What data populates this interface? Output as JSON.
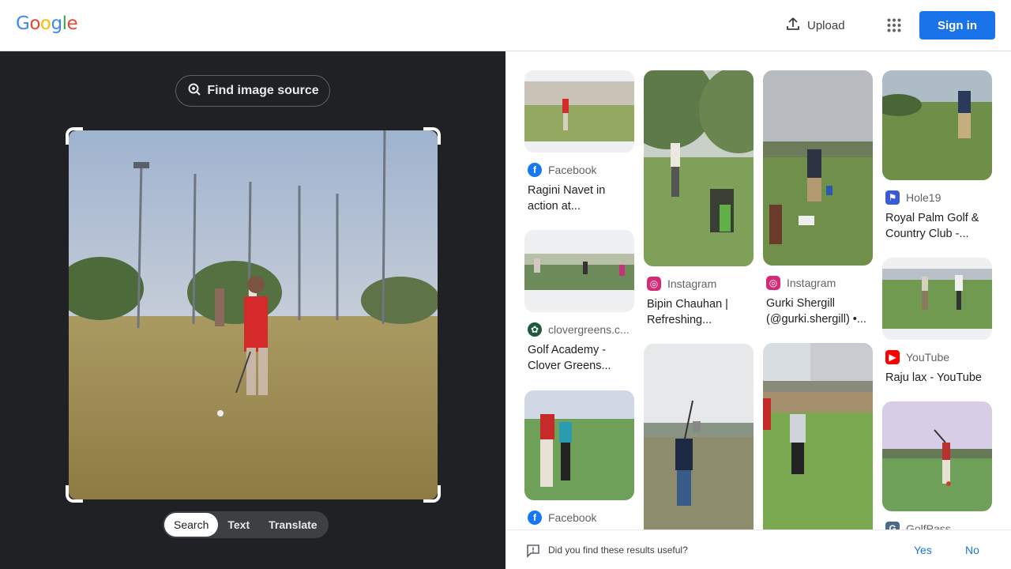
{
  "header": {
    "logo_letters": [
      "G",
      "o",
      "o",
      "g",
      "l",
      "e"
    ],
    "logo_colors": [
      "#4285f4",
      "#ea4335",
      "#fbbc05",
      "#4285f4",
      "#34a853",
      "#ea4335"
    ],
    "upload_label": "Upload",
    "upload_icon": "upload-icon",
    "apps_icon": "apps-grid-icon",
    "signin_label": "Sign in"
  },
  "lens": {
    "find_source_label": "Find image source",
    "find_source_icon": "lens-search-icon",
    "modes": [
      "Search",
      "Text",
      "Translate"
    ],
    "active_mode": "Search"
  },
  "results": [
    {
      "source": "Facebook",
      "icon": "facebook-icon",
      "title": "Ragini Navet in action at..."
    },
    {
      "source": "clovergreens.c...",
      "icon": "clovergreens-icon",
      "title": "Golf Academy - Clover Greens..."
    },
    {
      "source": "Facebook",
      "icon": "facebook-icon",
      "title": ""
    },
    {
      "source": "Instagram",
      "icon": "instagram-icon",
      "title": "Bipin Chauhan | Refreshing..."
    },
    {
      "source": "",
      "icon": "",
      "title": ""
    },
    {
      "source": "Instagram",
      "icon": "instagram-icon",
      "title": "Gurki Shergill (@gurki.shergill) •..."
    },
    {
      "source": "",
      "icon": "",
      "title": ""
    },
    {
      "source": "Hole19",
      "icon": "hole19-icon",
      "title": "Royal Palm Golf & Country Club -..."
    },
    {
      "source": "YouTube",
      "icon": "youtube-icon",
      "title": "Raju lax - YouTube"
    },
    {
      "source": "GolfPass",
      "icon": "golfpass-icon",
      "title": ""
    }
  ],
  "feedback": {
    "question": "Did you find these results useful?",
    "yes": "Yes",
    "no": "No",
    "icon": "feedback-icon"
  },
  "colors": {
    "accent": "#1a73e8",
    "panel_dark": "#202124",
    "facebook": "#1877f2",
    "instagram": "#d62976",
    "youtube": "#ff0000",
    "hole19": "#3a5bd9",
    "clovergreens": "#1e5a3c"
  }
}
